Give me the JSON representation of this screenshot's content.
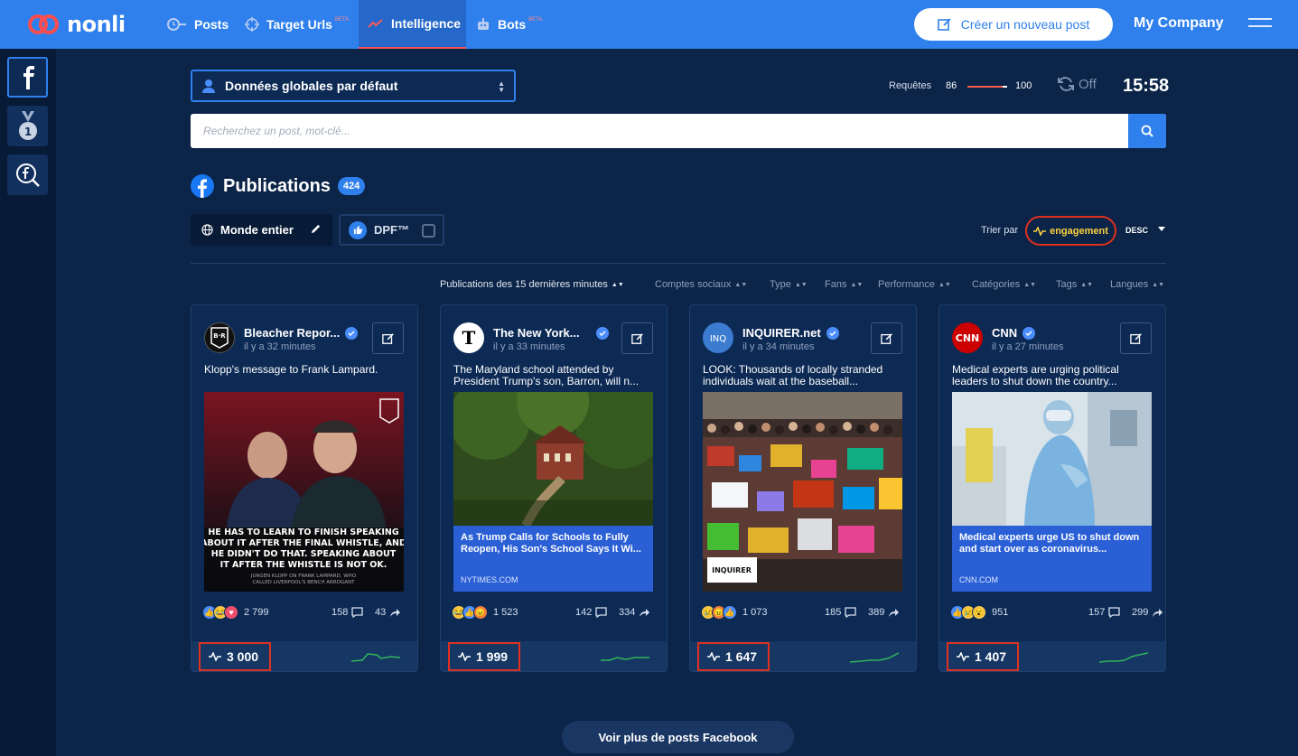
{
  "app": {
    "name": "nonli"
  },
  "nav": [
    {
      "label": "Posts",
      "beta": ""
    },
    {
      "label": "Target Urls",
      "beta": "BETA"
    },
    {
      "label": "Intelligence",
      "beta": ""
    },
    {
      "label": "Bots",
      "beta": "BETA"
    }
  ],
  "header": {
    "create_label": "Créer un nouveau post",
    "company": "My Company"
  },
  "filterbar": {
    "select_value": "Données globales par défaut",
    "requests_label": "Requêtes",
    "requests_used": "86",
    "requests_max": "100",
    "refresh_state": "Off",
    "time": "15:58"
  },
  "search": {
    "placeholder": "Recherchez un post, mot-clé..."
  },
  "publications": {
    "title": "Publications",
    "count": "424",
    "region": "Monde entier",
    "dpf": "DPF™",
    "sort_label": "Trier par",
    "sort_field": "engagement",
    "sort_dir": "DESC"
  },
  "filters": [
    "Publications des 15 dernières minutes",
    "Comptes sociaux",
    "Type",
    "Fans",
    "Performance",
    "Catégories",
    "Tags",
    "Langues"
  ],
  "cards": [
    {
      "name": "Bleacher Repor...",
      "time": "il y a 32 minutes",
      "text": "Klopp's message to Frank Lampard.",
      "link_title": "",
      "link_domain": "",
      "image_caption": "HE HAS TO LEARN TO FINISH SPEAKING ABOUT IT AFTER THE FINAL WHISTLE, AND HE DIDN'T DO THAT. SPEAKING ABOUT IT AFTER THE WHISTLE IS NOT OK.",
      "image_byline": "JURGEN KLOPP ON FRANK LAMPARD, WHO CALLED LIVERPOOL'S BENCH ARROGANT",
      "reactions": "2 799",
      "comments": "158",
      "shares": "43",
      "engagement": "3 000"
    },
    {
      "name": "The New York...",
      "time": "il y a 33 minutes",
      "text": "The Maryland school attended by President Trump's son, Barron, will n...",
      "link_title": "As Trump Calls for Schools to Fully Reopen, His Son's School Says It Wi...",
      "link_domain": "NYTIMES.COM",
      "reactions": "1 523",
      "comments": "142",
      "shares": "334",
      "engagement": "1 999"
    },
    {
      "name": "INQUIRER.net",
      "time": "il y a 34 minutes",
      "text": "LOOK: Thousands of locally stranded individuals wait at the baseball...",
      "link_title": "",
      "link_domain": "",
      "image_caption": "INQUIRER",
      "reactions": "1 073",
      "comments": "185",
      "shares": "389",
      "engagement": "1 647"
    },
    {
      "name": "CNN",
      "time": "il y a 27 minutes",
      "text": "Medical experts are urging political leaders to shut down the country...",
      "link_title": "Medical experts urge US to shut down and start over as coronavirus...",
      "link_domain": "CNN.COM",
      "reactions": "951",
      "comments": "157",
      "shares": "299",
      "engagement": "1 407"
    }
  ],
  "footer": {
    "more_label": "Voir plus de posts Facebook"
  },
  "colors": {
    "topbar": "#2f80ed",
    "background": "#0b2447",
    "highlight": "#e0301e",
    "engagement": "#ffd23f"
  }
}
